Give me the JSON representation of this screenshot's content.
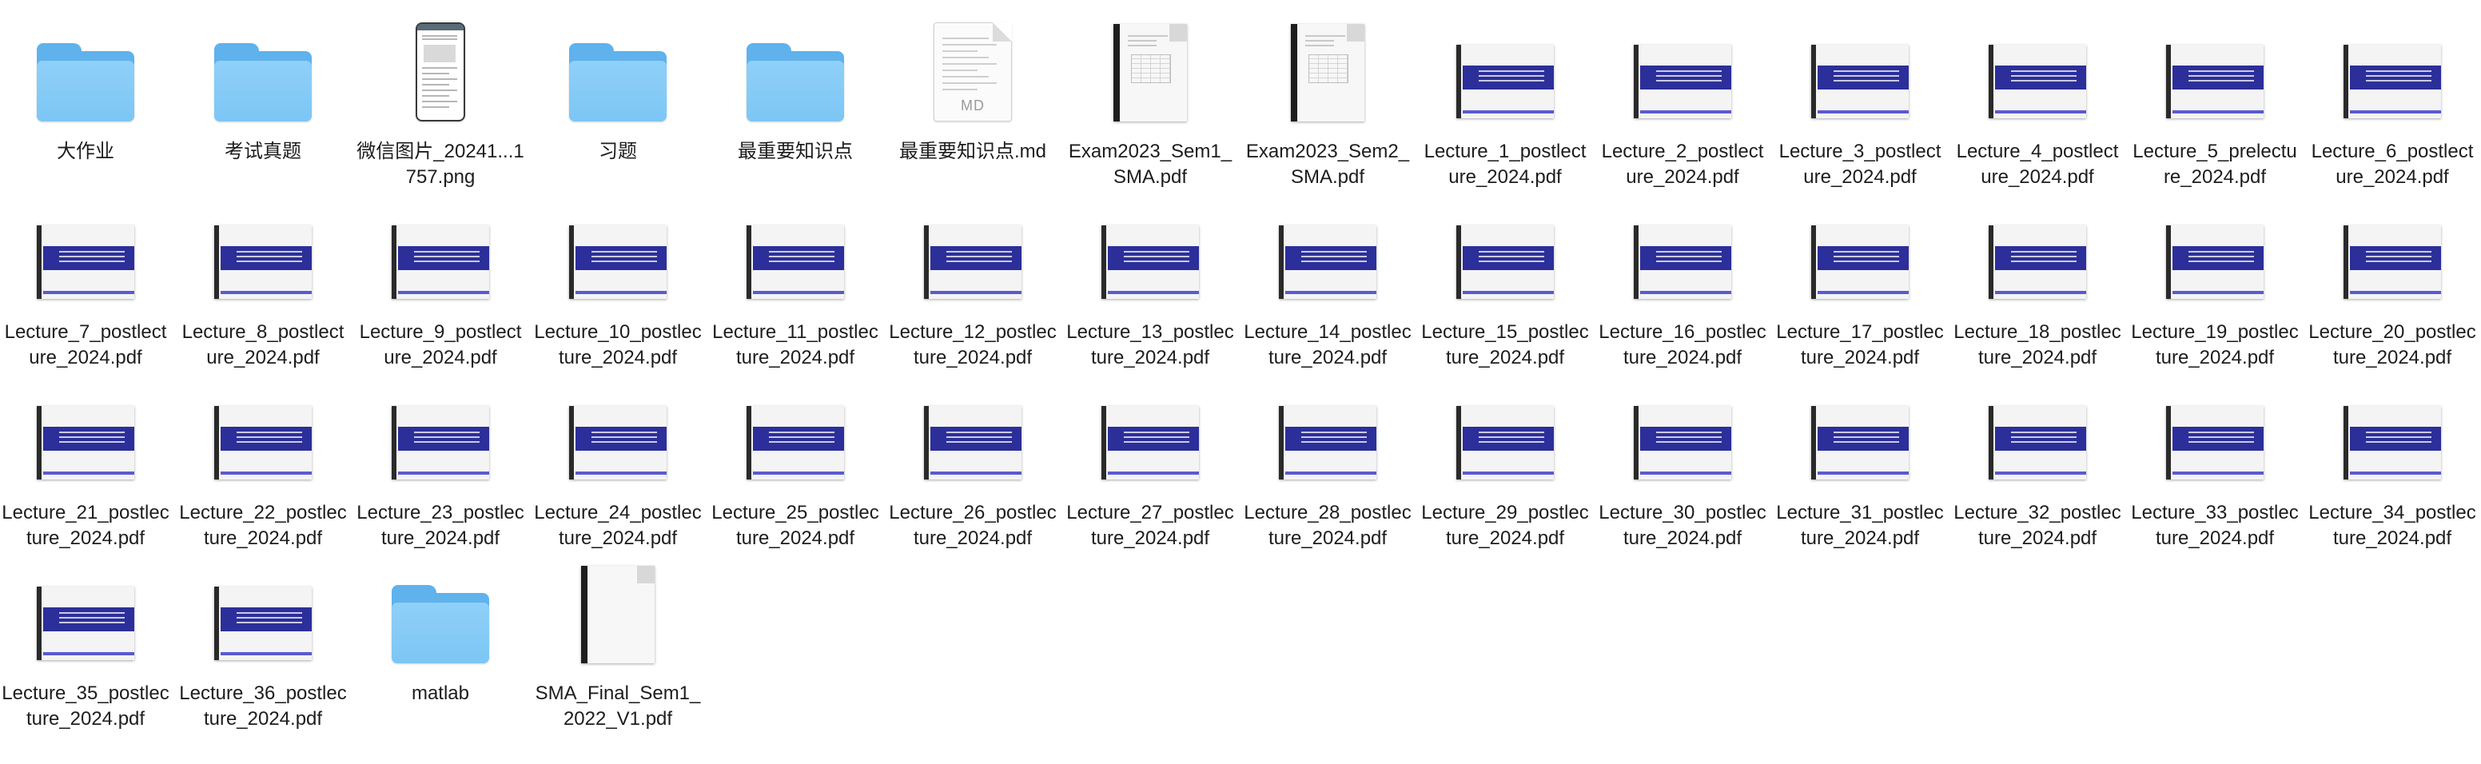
{
  "items": [
    {
      "kind": "folder",
      "name": "大作业"
    },
    {
      "kind": "folder",
      "name": "考试真题"
    },
    {
      "kind": "png",
      "name": "微信图片_20241...1757.png"
    },
    {
      "kind": "folder",
      "name": "习题"
    },
    {
      "kind": "folder",
      "name": "最重要知识点"
    },
    {
      "kind": "md",
      "name": "最重要知识点.md",
      "badge": "MD"
    },
    {
      "kind": "doc-table",
      "name": "Exam2023_Sem1_SMA.pdf"
    },
    {
      "kind": "doc-table",
      "name": "Exam2023_Sem2_SMA.pdf"
    },
    {
      "kind": "slide",
      "name": "Lecture_1_postlecture_2024.pdf"
    },
    {
      "kind": "slide",
      "name": "Lecture_2_postlecture_2024.pdf"
    },
    {
      "kind": "slide",
      "name": "Lecture_3_postlecture_2024.pdf"
    },
    {
      "kind": "slide",
      "name": "Lecture_4_postlecture_2024.pdf"
    },
    {
      "kind": "slide",
      "name": "Lecture_5_prelecture_2024.pdf"
    },
    {
      "kind": "slide",
      "name": "Lecture_6_postlecture_2024.pdf"
    },
    {
      "kind": "slide",
      "name": "Lecture_7_postlecture_2024.pdf"
    },
    {
      "kind": "slide",
      "name": "Lecture_8_postlecture_2024.pdf"
    },
    {
      "kind": "slide",
      "name": "Lecture_9_postlecture_2024.pdf"
    },
    {
      "kind": "slide",
      "name": "Lecture_10_postlecture_2024.pdf"
    },
    {
      "kind": "slide",
      "name": "Lecture_11_postlecture_2024.pdf"
    },
    {
      "kind": "slide",
      "name": "Lecture_12_postlecture_2024.pdf"
    },
    {
      "kind": "slide",
      "name": "Lecture_13_postlecture_2024.pdf"
    },
    {
      "kind": "slide",
      "name": "Lecture_14_postlecture_2024.pdf"
    },
    {
      "kind": "slide",
      "name": "Lecture_15_postlecture_2024.pdf"
    },
    {
      "kind": "slide",
      "name": "Lecture_16_postlecture_2024.pdf"
    },
    {
      "kind": "slide",
      "name": "Lecture_17_postlecture_2024.pdf"
    },
    {
      "kind": "slide",
      "name": "Lecture_18_postlecture_2024.pdf"
    },
    {
      "kind": "slide",
      "name": "Lecture_19_postlecture_2024.pdf"
    },
    {
      "kind": "slide",
      "name": "Lecture_20_postlecture_2024.pdf"
    },
    {
      "kind": "slide",
      "name": "Lecture_21_postlecture_2024.pdf"
    },
    {
      "kind": "slide",
      "name": "Lecture_22_postlecture_2024.pdf"
    },
    {
      "kind": "slide",
      "name": "Lecture_23_postlecture_2024.pdf"
    },
    {
      "kind": "slide",
      "name": "Lecture_24_postlecture_2024.pdf"
    },
    {
      "kind": "slide",
      "name": "Lecture_25_postlecture_2024.pdf"
    },
    {
      "kind": "slide",
      "name": "Lecture_26_postlecture_2024.pdf"
    },
    {
      "kind": "slide",
      "name": "Lecture_27_postlecture_2024.pdf"
    },
    {
      "kind": "slide",
      "name": "Lecture_28_postlecture_2024.pdf"
    },
    {
      "kind": "slide",
      "name": "Lecture_29_postlecture_2024.pdf"
    },
    {
      "kind": "slide",
      "name": "Lecture_30_postlecture_2024.pdf"
    },
    {
      "kind": "slide",
      "name": "Lecture_31_postlecture_2024.pdf"
    },
    {
      "kind": "slide",
      "name": "Lecture_32_postlecture_2024.pdf"
    },
    {
      "kind": "slide",
      "name": "Lecture_33_postlecture_2024.pdf"
    },
    {
      "kind": "slide",
      "name": "Lecture_34_postlecture_2024.pdf"
    },
    {
      "kind": "slide",
      "name": "Lecture_35_postlecture_2024.pdf"
    },
    {
      "kind": "slide",
      "name": "Lecture_36_postlecture_2024.pdf"
    },
    {
      "kind": "folder",
      "name": "matlab"
    },
    {
      "kind": "doc-blank",
      "name": "SMA_Final_Sem1_2022_V1.pdf"
    }
  ]
}
